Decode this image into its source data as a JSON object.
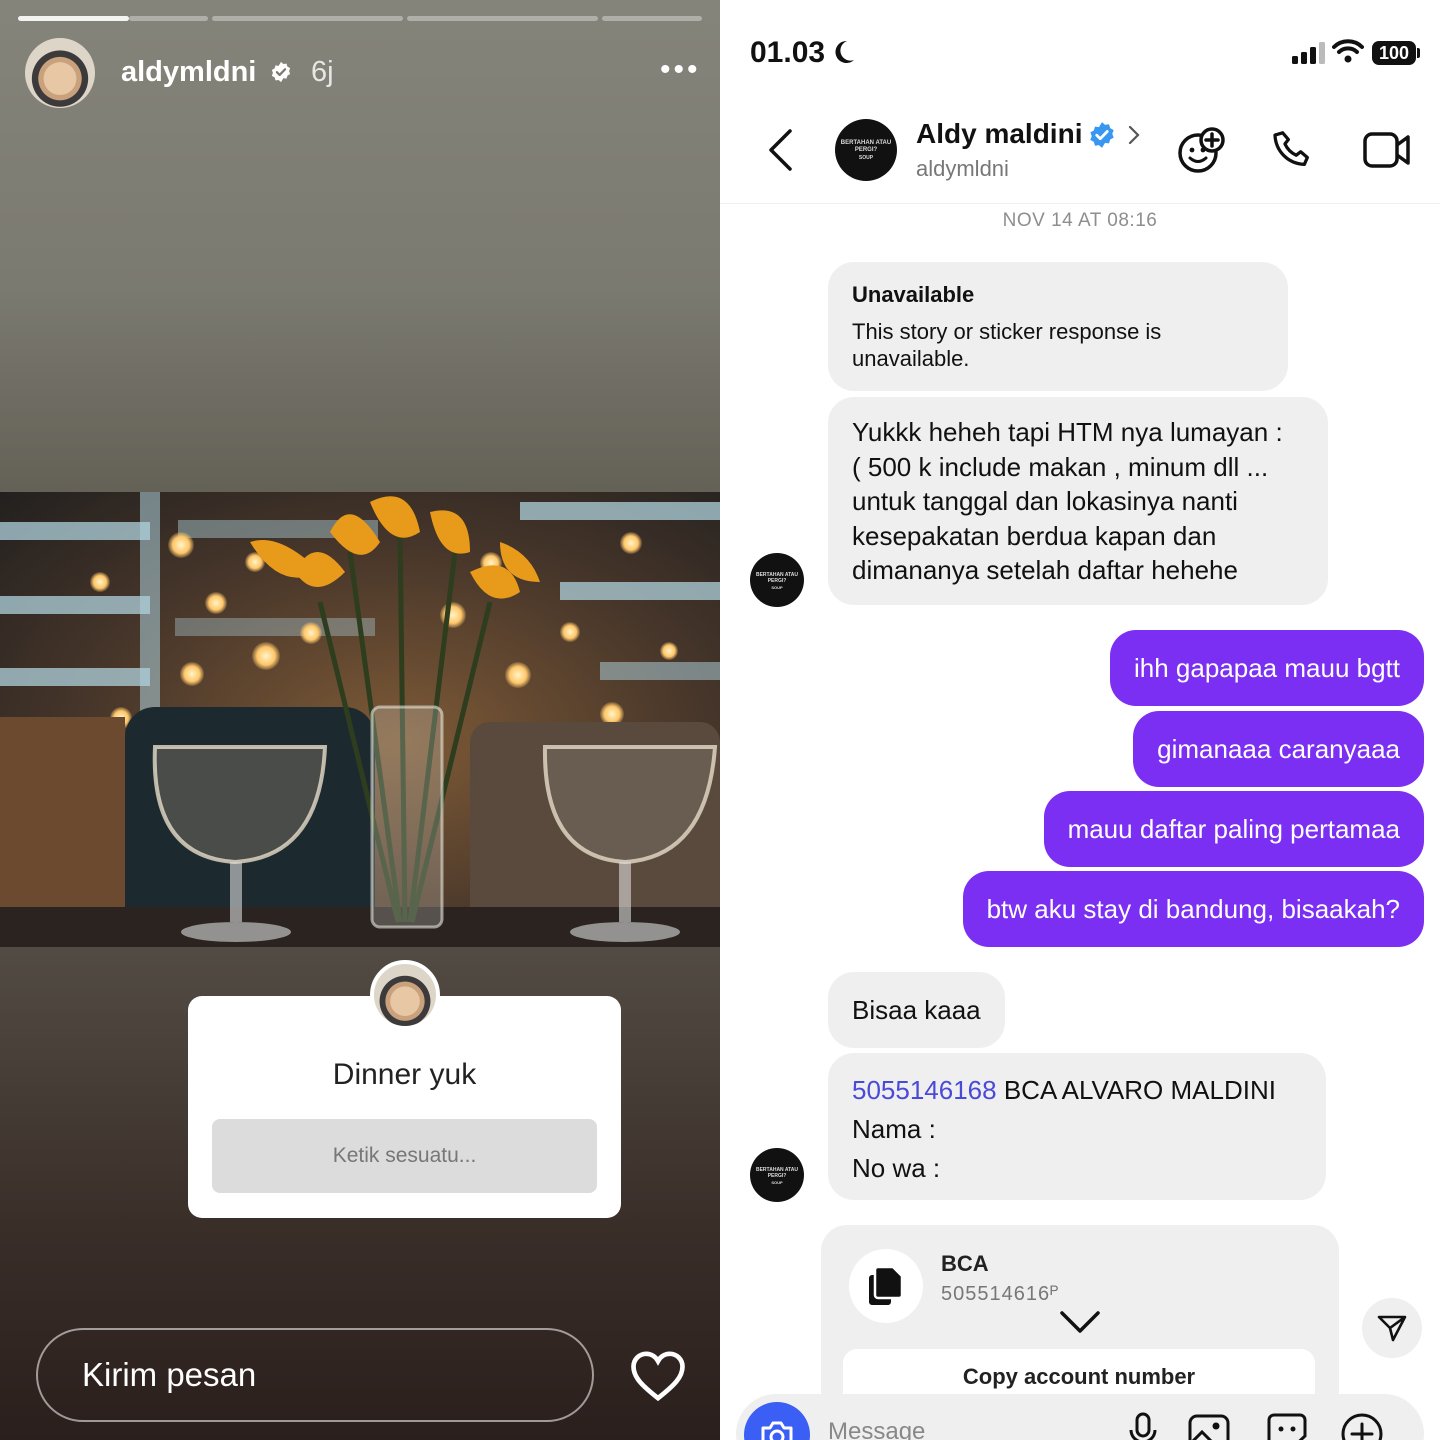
{
  "story": {
    "username": "aldymldni",
    "time_ago": "6j",
    "more_label": "•••",
    "sticker": {
      "title": "Dinner yuk",
      "input_placeholder": "Ketik sesuatu..."
    },
    "reply_placeholder": "Kirim pesan",
    "progress_segments": 4,
    "active_segment": 1
  },
  "status_bar": {
    "time": "01.03",
    "battery": "100"
  },
  "chat": {
    "header": {
      "name": "Aldy maldini",
      "handle": "aldymldni"
    },
    "avatar_text": [
      "BERTAHAN ATAU",
      "PERGI?",
      "SOUP"
    ],
    "date_separator": "NOV 14 AT 08:16",
    "unavailable": {
      "title": "Unavailable",
      "body": "This story or sticker response is unavailable."
    },
    "incoming_long": [
      "Yukkk heheh tapi HTM nya lumayan :",
      "( 500 k include makan , minum dll ...",
      "untuk tanggal dan lokasinya nanti",
      "kesepakatan berdua kapan dan",
      "dimananya setelah daftar hehehe"
    ],
    "outgoing": [
      "ihh gapapaa mauu bgtt",
      "gimanaaa caranyaaa",
      "mauu daftar paling pertamaa",
      "btw aku stay di bandung, bisaakah?"
    ],
    "incoming_short": "Bisaa kaaa",
    "account_msg": {
      "number": "5055146168",
      "bank_holder": " BCA ALVARO MALDINI",
      "line2": "Nama :",
      "line3": "No wa :"
    },
    "copy_card": {
      "bank": "BCA",
      "number": "505514616ᴾ",
      "button": "Copy account number"
    },
    "composer_placeholder": "Message"
  },
  "colors": {
    "outgoing_bubble": "#7b2ff2",
    "incoming_bubble": "#efeff0",
    "verified": "#3897f0",
    "link": "#4a4ad8"
  }
}
